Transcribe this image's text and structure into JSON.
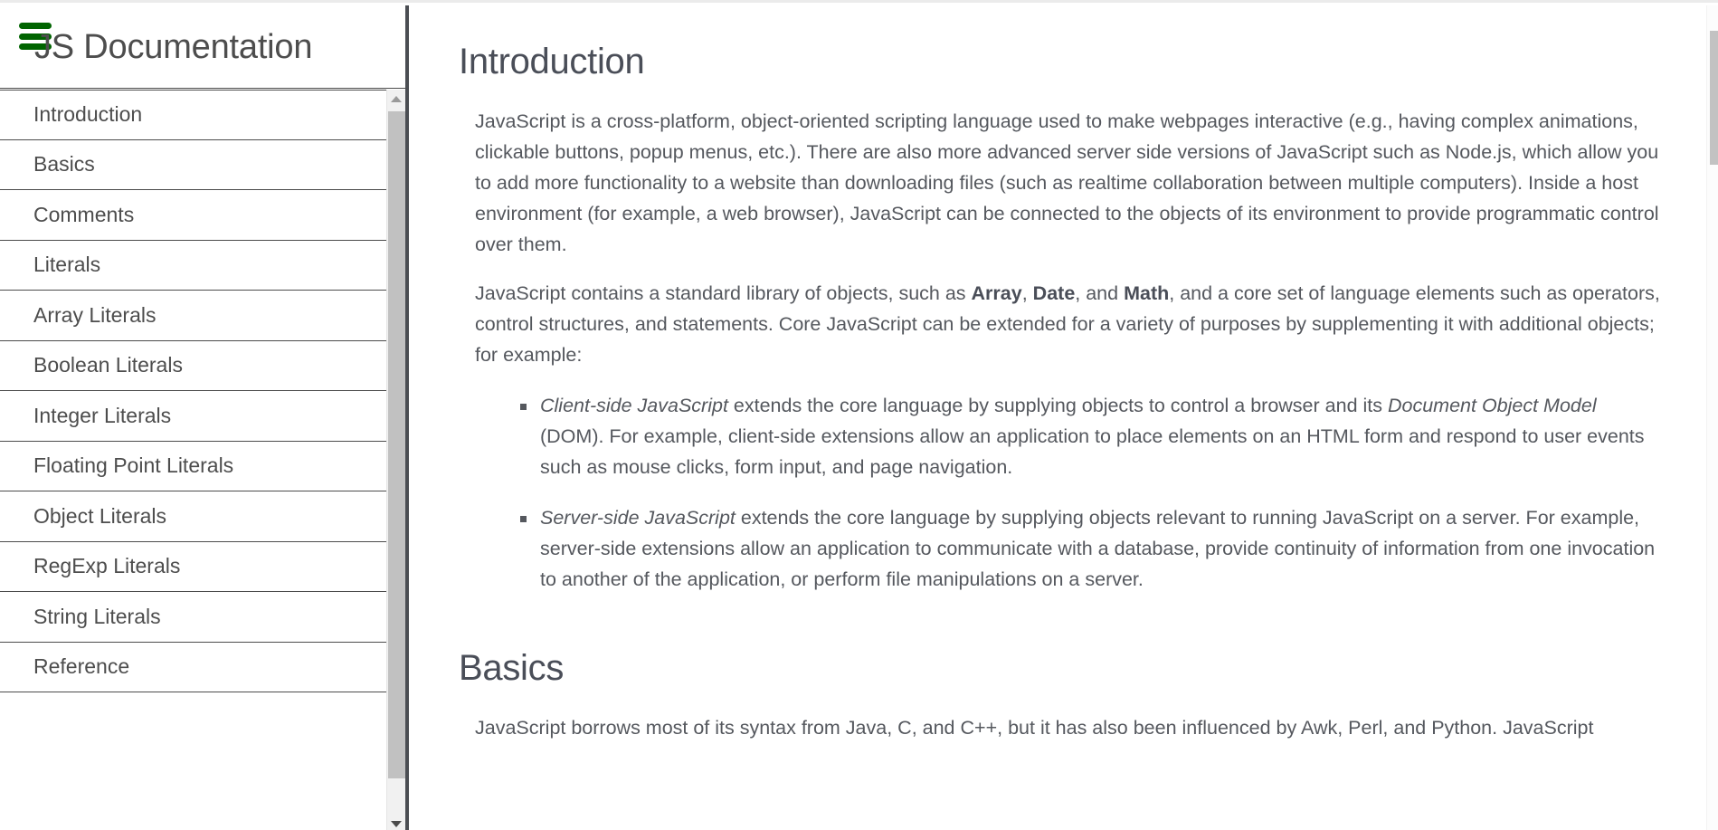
{
  "sidebar": {
    "menu_icon": "hamburger-menu-icon",
    "title": "JS Documentation",
    "items": [
      {
        "label": "Introduction"
      },
      {
        "label": "Basics"
      },
      {
        "label": "Comments"
      },
      {
        "label": "Literals"
      },
      {
        "label": "Array Literals"
      },
      {
        "label": "Boolean Literals"
      },
      {
        "label": "Integer Literals"
      },
      {
        "label": "Floating Point Literals"
      },
      {
        "label": "Object Literals"
      },
      {
        "label": "RegExp Literals"
      },
      {
        "label": "String Literals"
      },
      {
        "label": "Reference"
      }
    ],
    "scrollbar": {
      "up_arrow_icon": "scroll-up-arrow-icon",
      "down_arrow_icon": "scroll-down-arrow-icon"
    }
  },
  "main": {
    "sections": [
      {
        "id": "introduction",
        "header": "Introduction",
        "paragraph_1": "JavaScript is a cross-platform, object-oriented scripting language used to make webpages interactive (e.g., having complex animations, clickable buttons, popup menus, etc.). There are also more advanced server side versions of JavaScript such as Node.js, which allow you to add more functionality to a website than downloading files (such as realtime collaboration between multiple computers). Inside a host environment (for example, a web browser), JavaScript can be connected to the objects of its environment to provide programmatic control over them.",
        "paragraph_2_part_1": "JavaScript contains a standard library of objects, such as ",
        "paragraph_2_bold_1": "Array",
        "paragraph_2_part_2": ", ",
        "paragraph_2_bold_2": "Date",
        "paragraph_2_part_3": ", and ",
        "paragraph_2_bold_3": "Math",
        "paragraph_2_part_4": ", and a core set of language elements such as operators, control structures, and statements. Core JavaScript can be extended for a variety of purposes by supplementing it with additional objects; for example:",
        "bullets": [
          {
            "italic_1": "Client-side JavaScript",
            "text_1": " extends the core language by supplying objects to control a browser and its ",
            "italic_2": "Document Object Model",
            "text_2": " (DOM). For example, client-side extensions allow an application to place elements on an HTML form and respond to user events such as mouse clicks, form input, and page navigation."
          },
          {
            "italic_1": "Server-side JavaScript",
            "text_1": " extends the core language by supplying objects relevant to running JavaScript on a server. For example, server-side extensions allow an application to communicate with a database, provide continuity of information from one invocation to another of the application, or perform file manipulations on a server.",
            "italic_2": "",
            "text_2": ""
          }
        ]
      },
      {
        "id": "basics",
        "header": "Basics",
        "paragraph_1": "JavaScript borrows most of its syntax from Java, C, and C++, but it has also been influenced by Awk, Perl, and Python. JavaScript"
      }
    ]
  },
  "colors": {
    "menu_icon_green": "#006400",
    "divider_dark": "#4b4e53",
    "body_text": "#55585e",
    "heading_text": "#4a4e58",
    "scroll_thumb": "#c1c1c1"
  }
}
